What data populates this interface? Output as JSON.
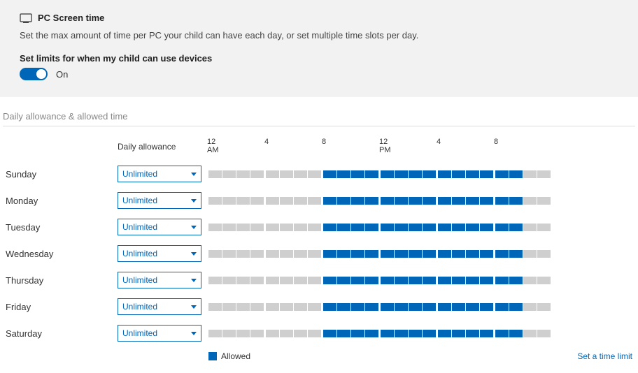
{
  "header": {
    "title": "PC Screen time",
    "description": "Set the max amount of time per PC your child can have each day, or set multiple time slots per day.",
    "toggle_label": "Set limits for when my child can use devices",
    "toggle_state": "On"
  },
  "section_title": "Daily allowance & allowed time",
  "columns": {
    "allowance": "Daily allowance"
  },
  "time_ticks": [
    {
      "label": "12\nAM",
      "hour": 0
    },
    {
      "label": "4",
      "hour": 4
    },
    {
      "label": "8",
      "hour": 8
    },
    {
      "label": "12\nPM",
      "hour": 12
    },
    {
      "label": "4",
      "hour": 16
    },
    {
      "label": "8",
      "hour": 20
    }
  ],
  "days": [
    {
      "name": "Sunday",
      "allowance": "Unlimited",
      "allowed_start": 8,
      "allowed_end": 22
    },
    {
      "name": "Monday",
      "allowance": "Unlimited",
      "allowed_start": 8,
      "allowed_end": 22
    },
    {
      "name": "Tuesday",
      "allowance": "Unlimited",
      "allowed_start": 8,
      "allowed_end": 22
    },
    {
      "name": "Wednesday",
      "allowance": "Unlimited",
      "allowed_start": 8,
      "allowed_end": 22
    },
    {
      "name": "Thursday",
      "allowance": "Unlimited",
      "allowed_start": 8,
      "allowed_end": 22
    },
    {
      "name": "Friday",
      "allowance": "Unlimited",
      "allowed_start": 8,
      "allowed_end": 22
    },
    {
      "name": "Saturday",
      "allowance": "Unlimited",
      "allowed_start": 8,
      "allowed_end": 22
    }
  ],
  "legend": {
    "allowed": "Allowed"
  },
  "footer_link": "Set a time limit",
  "colors": {
    "accent": "#0067b8",
    "cell_off": "#cfcfcf",
    "header_bg": "#f2f2f2"
  }
}
